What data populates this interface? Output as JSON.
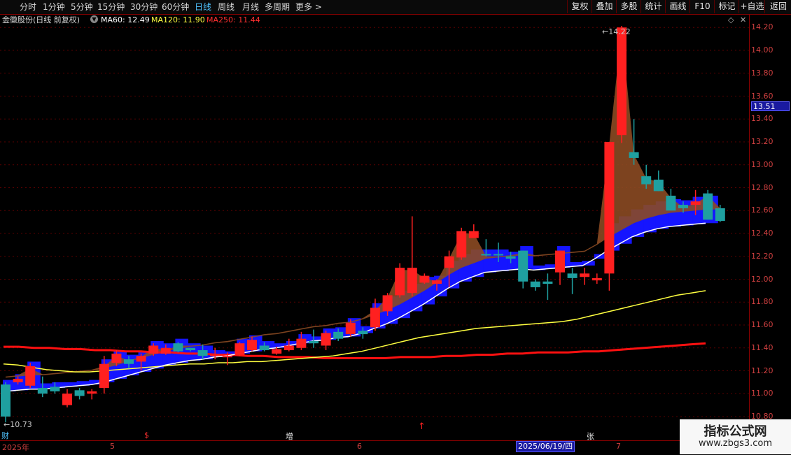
{
  "toolbar": {
    "periods": [
      "分时",
      "1分钟",
      "5分钟",
      "15分钟",
      "30分钟",
      "60分钟",
      "日线",
      "周线",
      "月线",
      "多周期",
      "更多 >"
    ],
    "active_period": "日线",
    "buttons": [
      "复权",
      "叠加",
      "多股",
      "统计",
      "画线",
      "F10",
      "标记",
      "+自选",
      "返回"
    ]
  },
  "infobar": {
    "stock": "金徽股份(日线 前复权)",
    "ma60": "MA60: 12.49",
    "ma120": "MA120: 11.90",
    "ma250": "MA250: 11.44"
  },
  "yaxis": {
    "ticks": [
      "14.20",
      "14.00",
      "13.80",
      "13.60",
      "13.40",
      "13.20",
      "13.00",
      "12.80",
      "12.60",
      "12.40",
      "12.20",
      "12.00",
      "11.80",
      "11.60",
      "11.40",
      "11.20",
      "11.00",
      "10.80"
    ],
    "current_price": "13.51"
  },
  "annotations": {
    "high": "14.22",
    "low": "10.73"
  },
  "datebar": {
    "labels": [
      "2025年",
      "5",
      "6",
      "7"
    ],
    "cursor": "2025/06/19/四",
    "markers": [
      "财",
      "$",
      "增",
      "张"
    ]
  },
  "colors": {
    "up": "#ff2020",
    "down": "#1fa0a0",
    "ma60": "#ffffff",
    "ma120": "#ffff40",
    "ma250": "#ff1010",
    "band_fill": "#8b4a22",
    "band_blue": "#1515ff",
    "accent_blue": "#4fc3ff"
  },
  "watermark": {
    "title": "指标公式网",
    "url": "www.zbgs3.com"
  },
  "chart_data": {
    "type": "candlestick",
    "ylim": [
      10.73,
      14.26
    ],
    "candles": [
      {
        "o": 11.08,
        "h": 11.1,
        "l": 10.75,
        "c": 10.8
      },
      {
        "o": 11.1,
        "h": 11.15,
        "l": 11.08,
        "c": 11.13
      },
      {
        "o": 11.07,
        "h": 11.27,
        "l": 11.05,
        "c": 11.24
      },
      {
        "o": 11.05,
        "h": 11.15,
        "l": 10.97,
        "c": 11.0
      },
      {
        "o": 11.06,
        "h": 11.1,
        "l": 11.0,
        "c": 11.02
      },
      {
        "o": 10.9,
        "h": 11.04,
        "l": 10.88,
        "c": 11.0
      },
      {
        "o": 11.03,
        "h": 11.05,
        "l": 10.95,
        "c": 10.98
      },
      {
        "o": 11.0,
        "h": 11.04,
        "l": 10.95,
        "c": 11.02
      },
      {
        "o": 11.05,
        "h": 11.33,
        "l": 11.0,
        "c": 11.26
      },
      {
        "o": 11.27,
        "h": 11.38,
        "l": 11.24,
        "c": 11.35
      },
      {
        "o": 11.3,
        "h": 11.33,
        "l": 11.22,
        "c": 11.26
      },
      {
        "o": 11.28,
        "h": 11.35,
        "l": 11.2,
        "c": 11.33
      },
      {
        "o": 11.35,
        "h": 11.44,
        "l": 11.33,
        "c": 11.42
      },
      {
        "o": 11.35,
        "h": 11.43,
        "l": 11.34,
        "c": 11.4
      },
      {
        "o": 11.44,
        "h": 11.45,
        "l": 11.36,
        "c": 11.37
      },
      {
        "o": 11.4,
        "h": 11.4,
        "l": 11.37,
        "c": 11.38
      },
      {
        "o": 11.38,
        "h": 11.43,
        "l": 11.3,
        "c": 11.33
      },
      {
        "o": 11.33,
        "h": 11.4,
        "l": 11.3,
        "c": 11.34
      },
      {
        "o": 11.32,
        "h": 11.36,
        "l": 11.25,
        "c": 11.33
      },
      {
        "o": 11.34,
        "h": 11.45,
        "l": 11.33,
        "c": 11.44
      },
      {
        "o": 11.38,
        "h": 11.5,
        "l": 11.37,
        "c": 11.47
      },
      {
        "o": 11.42,
        "h": 11.45,
        "l": 11.37,
        "c": 11.38
      },
      {
        "o": 11.35,
        "h": 11.41,
        "l": 11.34,
        "c": 11.39
      },
      {
        "o": 11.38,
        "h": 11.48,
        "l": 11.37,
        "c": 11.42
      },
      {
        "o": 11.4,
        "h": 11.54,
        "l": 11.38,
        "c": 11.48
      },
      {
        "o": 11.46,
        "h": 11.56,
        "l": 11.4,
        "c": 11.44
      },
      {
        "o": 11.42,
        "h": 11.55,
        "l": 11.38,
        "c": 11.53
      },
      {
        "o": 11.54,
        "h": 11.57,
        "l": 11.46,
        "c": 11.48
      },
      {
        "o": 11.52,
        "h": 11.65,
        "l": 11.5,
        "c": 11.62
      },
      {
        "o": 11.55,
        "h": 11.58,
        "l": 11.48,
        "c": 11.52
      },
      {
        "o": 11.58,
        "h": 11.83,
        "l": 11.55,
        "c": 11.75
      },
      {
        "o": 11.72,
        "h": 11.88,
        "l": 11.68,
        "c": 11.86
      },
      {
        "o": 11.86,
        "h": 12.14,
        "l": 11.84,
        "c": 12.1
      },
      {
        "o": 11.88,
        "h": 12.55,
        "l": 11.85,
        "c": 12.1
      },
      {
        "o": 11.97,
        "h": 12.05,
        "l": 11.96,
        "c": 12.03
      },
      {
        "o": 11.96,
        "h": 12.0,
        "l": 11.9,
        "c": 11.99
      },
      {
        "o": 12.1,
        "h": 12.25,
        "l": 11.93,
        "c": 12.2
      },
      {
        "o": 12.19,
        "h": 12.45,
        "l": 12.17,
        "c": 12.42
      },
      {
        "o": 12.36,
        "h": 12.48,
        "l": 12.36,
        "c": 12.42
      },
      {
        "o": 12.22,
        "h": 12.35,
        "l": 12.2,
        "c": 12.21
      },
      {
        "o": 12.22,
        "h": 12.32,
        "l": 12.15,
        "c": 12.21
      },
      {
        "o": 12.2,
        "h": 12.24,
        "l": 12.14,
        "c": 12.18
      },
      {
        "o": 12.25,
        "h": 12.25,
        "l": 11.92,
        "c": 11.98
      },
      {
        "o": 11.98,
        "h": 12.0,
        "l": 11.9,
        "c": 11.93
      },
      {
        "o": 11.98,
        "h": 12.05,
        "l": 11.82,
        "c": 11.96
      },
      {
        "o": 12.06,
        "h": 12.25,
        "l": 11.95,
        "c": 12.25
      },
      {
        "o": 12.05,
        "h": 12.1,
        "l": 11.87,
        "c": 12.01
      },
      {
        "o": 12.02,
        "h": 12.1,
        "l": 11.95,
        "c": 12.05
      },
      {
        "o": 11.99,
        "h": 12.05,
        "l": 11.96,
        "c": 12.01
      },
      {
        "o": 12.05,
        "h": 13.2,
        "l": 11.9,
        "c": 13.2
      },
      {
        "o": 13.26,
        "h": 14.22,
        "l": 13.19,
        "c": 14.2
      },
      {
        "o": 13.11,
        "h": 13.4,
        "l": 13.0,
        "c": 13.06
      },
      {
        "o": 12.9,
        "h": 13.0,
        "l": 12.79,
        "c": 12.83
      },
      {
        "o": 12.87,
        "h": 12.95,
        "l": 12.77,
        "c": 12.77
      },
      {
        "o": 12.73,
        "h": 12.79,
        "l": 12.62,
        "c": 12.6
      },
      {
        "o": 12.65,
        "h": 12.68,
        "l": 12.58,
        "c": 12.62
      },
      {
        "o": 12.65,
        "h": 12.78,
        "l": 12.56,
        "c": 12.68
      },
      {
        "o": 12.75,
        "h": 12.78,
        "l": 12.54,
        "c": 12.52
      },
      {
        "o": 12.62,
        "h": 12.65,
        "l": 12.5,
        "c": 12.51
      }
    ],
    "ma60": [
      11.02,
      11.03,
      11.04,
      11.04,
      11.05,
      11.06,
      11.07,
      11.08,
      11.1,
      11.13,
      11.16,
      11.19,
      11.22,
      11.25,
      11.27,
      11.29,
      11.3,
      11.32,
      11.33,
      11.35,
      11.37,
      11.39,
      11.4,
      11.42,
      11.44,
      11.46,
      11.47,
      11.49,
      11.5,
      11.53,
      11.57,
      11.61,
      11.66,
      11.72,
      11.78,
      11.85,
      11.92,
      11.98,
      12.02,
      12.06,
      12.07,
      12.08,
      12.09,
      12.08,
      12.09,
      12.1,
      12.11,
      12.12,
      12.18,
      12.25,
      12.31,
      12.37,
      12.41,
      12.44,
      12.46,
      12.47,
      12.48,
      12.49
    ],
    "ma120": [
      11.26,
      11.25,
      11.23,
      11.21,
      11.2,
      11.19,
      11.19,
      11.2,
      11.21,
      11.22,
      11.23,
      11.24,
      11.25,
      11.26,
      11.26,
      11.27,
      11.27,
      11.28,
      11.28,
      11.29,
      11.3,
      11.31,
      11.32,
      11.33,
      11.35,
      11.37,
      11.4,
      11.43,
      11.46,
      11.49,
      11.51,
      11.53,
      11.55,
      11.57,
      11.58,
      11.59,
      11.6,
      11.61,
      11.62,
      11.63,
      11.65,
      11.68,
      11.71,
      11.74,
      11.77,
      11.8,
      11.83,
      11.86,
      11.88,
      11.9
    ],
    "ma250": [
      11.41,
      11.41,
      11.4,
      11.4,
      11.39,
      11.39,
      11.38,
      11.38,
      11.37,
      11.37,
      11.36,
      11.36,
      11.35,
      11.35,
      11.34,
      11.34,
      11.33,
      11.33,
      11.32,
      11.32,
      11.32,
      11.31,
      11.31,
      11.31,
      11.31,
      11.31,
      11.32,
      11.32,
      11.32,
      11.33,
      11.33,
      11.34,
      11.34,
      11.35,
      11.35,
      11.36,
      11.36,
      11.36,
      11.37,
      11.37,
      11.38,
      11.39,
      11.4,
      11.41,
      11.42,
      11.43,
      11.44
    ]
  }
}
